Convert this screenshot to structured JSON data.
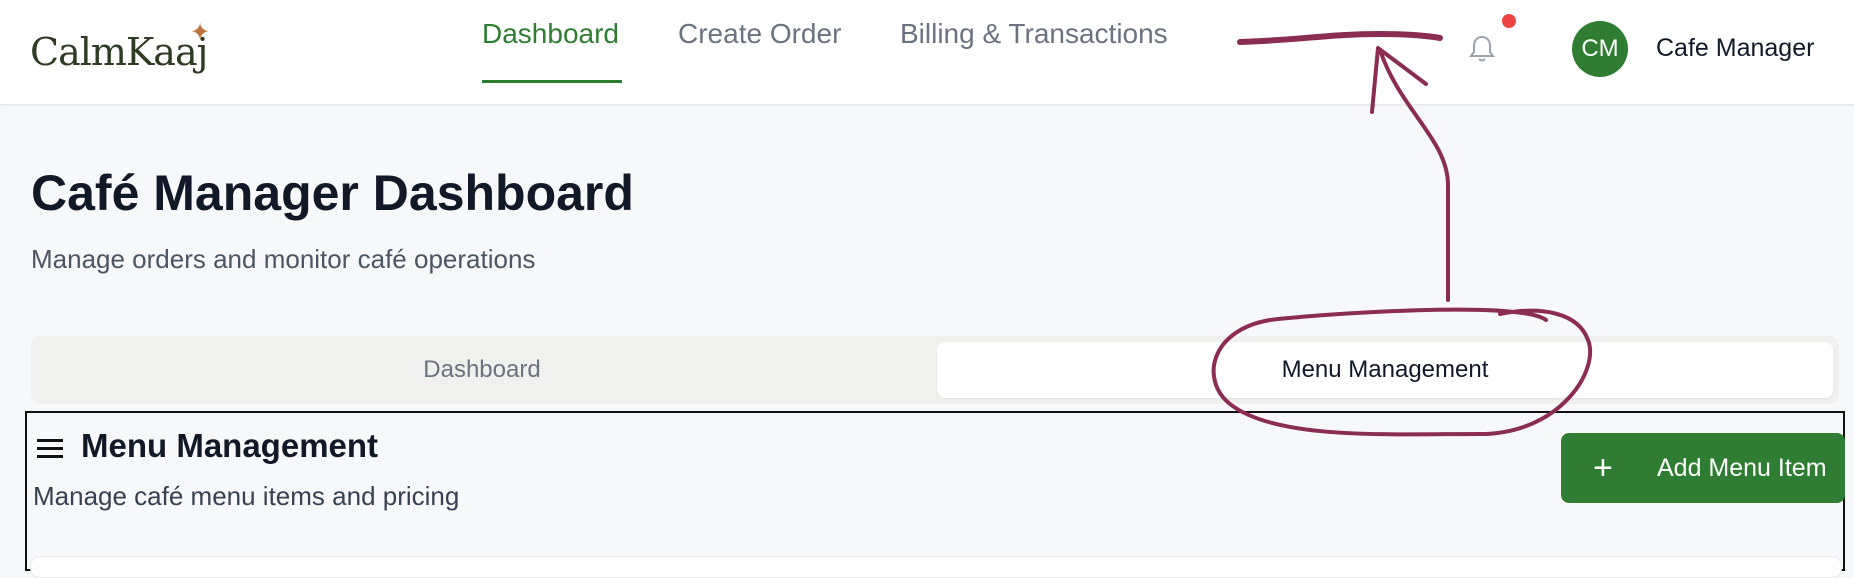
{
  "brand": {
    "logo_text": "CalmKaaj"
  },
  "nav": {
    "items": [
      {
        "label": "Dashboard",
        "active": true
      },
      {
        "label": "Create Order",
        "active": false
      },
      {
        "label": "Billing & Transactions",
        "active": false
      }
    ]
  },
  "header": {
    "avatar_initials": "CM",
    "user_name": "Cafe Manager",
    "notification_icon": "bell-icon"
  },
  "page": {
    "title": "Café Manager Dashboard",
    "subtitle": "Manage orders and monitor café operations"
  },
  "tabs": [
    {
      "label": "Dashboard",
      "selected": false
    },
    {
      "label": "Menu Management",
      "selected": true
    }
  ],
  "section": {
    "title": "Menu Management",
    "subtitle": "Manage café menu items and pricing",
    "add_button_label": "Add Menu Item"
  },
  "colors": {
    "accent": "#2e7d32",
    "annotation": "#8b2c52",
    "notification_dot": "#ef4444"
  }
}
